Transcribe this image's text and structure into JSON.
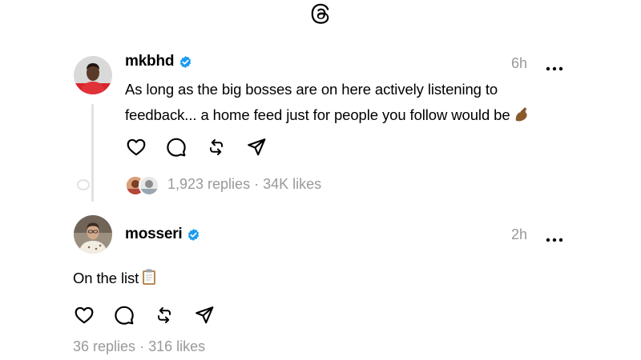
{
  "app": {
    "logo_icon": "threads-logo-icon"
  },
  "colors": {
    "verified": "#1d9bf0",
    "muted": "#999999",
    "thread_line": "#e2e2e2"
  },
  "posts": [
    {
      "username": "mkbhd",
      "verified": true,
      "time": "6h",
      "text": "As long as the big bosses are on here actively listening to feedback... a home feed just for people you follow would be",
      "emoji": "pinched-fingers-emoji",
      "actions": [
        "heart-icon",
        "comment-icon",
        "repost-icon",
        "share-icon"
      ],
      "stats": {
        "replies": "1,923 replies",
        "separator": "·",
        "likes": "34K likes"
      }
    },
    {
      "username": "mosseri",
      "verified": true,
      "time": "2h",
      "text": "On the list",
      "emoji": "clipboard-emoji",
      "actions": [
        "heart-icon",
        "comment-icon",
        "repost-icon",
        "share-icon"
      ],
      "stats": {
        "replies": "36 replies",
        "separator": "·",
        "likes": "316 likes"
      }
    }
  ]
}
